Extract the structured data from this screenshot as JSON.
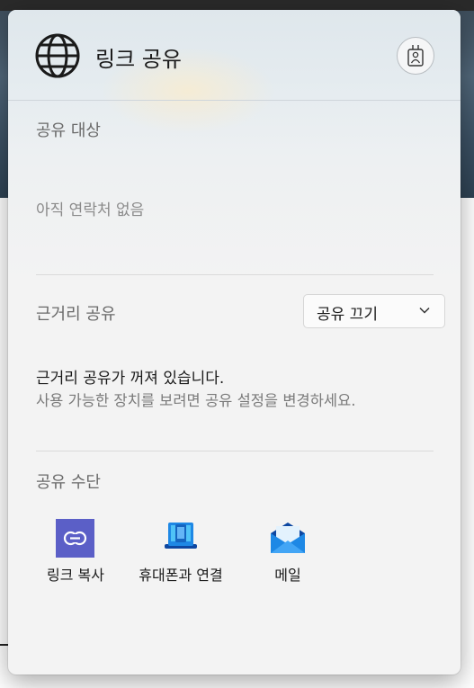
{
  "panel": {
    "title": "링크 공유",
    "header_icon": "globe-icon",
    "profile_icon": "id-badge-icon"
  },
  "share_with": {
    "label": "공유 대상",
    "empty_text": "아직 연락처 없음"
  },
  "nearby": {
    "label": "근거리 공유",
    "dropdown_value": "공유 끄기",
    "status_title": "근거리 공유가 꺼져 있습니다.",
    "status_detail": "사용 가능한 장치를 보려면 공유 설정을 변경하세요."
  },
  "methods": {
    "label": "공유 수단",
    "items": [
      {
        "label": "링크 복사",
        "icon": "link-copy-icon"
      },
      {
        "label": "휴대폰과 연결",
        "icon": "phone-link-icon"
      },
      {
        "label": "메일",
        "icon": "mail-icon"
      }
    ]
  },
  "colors": {
    "accent_link": "#5b5fc7",
    "mail_blue": "#1e88e5",
    "phone_blue": "#1565c0"
  }
}
